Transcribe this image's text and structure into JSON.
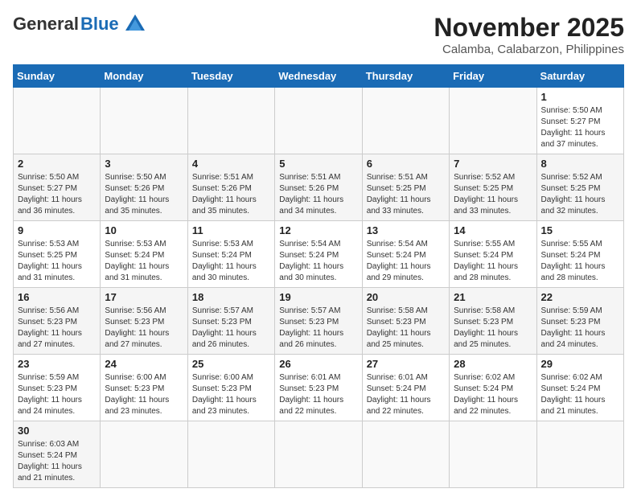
{
  "header": {
    "logo_general": "General",
    "logo_blue": "Blue",
    "month_title": "November 2025",
    "location": "Calamba, Calabarzon, Philippines"
  },
  "weekdays": [
    "Sunday",
    "Monday",
    "Tuesday",
    "Wednesday",
    "Thursday",
    "Friday",
    "Saturday"
  ],
  "weeks": [
    [
      {
        "day": null,
        "info": null
      },
      {
        "day": null,
        "info": null
      },
      {
        "day": null,
        "info": null
      },
      {
        "day": null,
        "info": null
      },
      {
        "day": null,
        "info": null
      },
      {
        "day": null,
        "info": null
      },
      {
        "day": "1",
        "info": "Sunrise: 5:50 AM\nSunset: 5:27 PM\nDaylight: 11 hours\nand 37 minutes."
      }
    ],
    [
      {
        "day": "2",
        "info": "Sunrise: 5:50 AM\nSunset: 5:27 PM\nDaylight: 11 hours\nand 36 minutes."
      },
      {
        "day": "3",
        "info": "Sunrise: 5:50 AM\nSunset: 5:26 PM\nDaylight: 11 hours\nand 35 minutes."
      },
      {
        "day": "4",
        "info": "Sunrise: 5:51 AM\nSunset: 5:26 PM\nDaylight: 11 hours\nand 35 minutes."
      },
      {
        "day": "5",
        "info": "Sunrise: 5:51 AM\nSunset: 5:26 PM\nDaylight: 11 hours\nand 34 minutes."
      },
      {
        "day": "6",
        "info": "Sunrise: 5:51 AM\nSunset: 5:25 PM\nDaylight: 11 hours\nand 33 minutes."
      },
      {
        "day": "7",
        "info": "Sunrise: 5:52 AM\nSunset: 5:25 PM\nDaylight: 11 hours\nand 33 minutes."
      },
      {
        "day": "8",
        "info": "Sunrise: 5:52 AM\nSunset: 5:25 PM\nDaylight: 11 hours\nand 32 minutes."
      }
    ],
    [
      {
        "day": "9",
        "info": "Sunrise: 5:53 AM\nSunset: 5:25 PM\nDaylight: 11 hours\nand 31 minutes."
      },
      {
        "day": "10",
        "info": "Sunrise: 5:53 AM\nSunset: 5:24 PM\nDaylight: 11 hours\nand 31 minutes."
      },
      {
        "day": "11",
        "info": "Sunrise: 5:53 AM\nSunset: 5:24 PM\nDaylight: 11 hours\nand 30 minutes."
      },
      {
        "day": "12",
        "info": "Sunrise: 5:54 AM\nSunset: 5:24 PM\nDaylight: 11 hours\nand 30 minutes."
      },
      {
        "day": "13",
        "info": "Sunrise: 5:54 AM\nSunset: 5:24 PM\nDaylight: 11 hours\nand 29 minutes."
      },
      {
        "day": "14",
        "info": "Sunrise: 5:55 AM\nSunset: 5:24 PM\nDaylight: 11 hours\nand 28 minutes."
      },
      {
        "day": "15",
        "info": "Sunrise: 5:55 AM\nSunset: 5:24 PM\nDaylight: 11 hours\nand 28 minutes."
      }
    ],
    [
      {
        "day": "16",
        "info": "Sunrise: 5:56 AM\nSunset: 5:23 PM\nDaylight: 11 hours\nand 27 minutes."
      },
      {
        "day": "17",
        "info": "Sunrise: 5:56 AM\nSunset: 5:23 PM\nDaylight: 11 hours\nand 27 minutes."
      },
      {
        "day": "18",
        "info": "Sunrise: 5:57 AM\nSunset: 5:23 PM\nDaylight: 11 hours\nand 26 minutes."
      },
      {
        "day": "19",
        "info": "Sunrise: 5:57 AM\nSunset: 5:23 PM\nDaylight: 11 hours\nand 26 minutes."
      },
      {
        "day": "20",
        "info": "Sunrise: 5:58 AM\nSunset: 5:23 PM\nDaylight: 11 hours\nand 25 minutes."
      },
      {
        "day": "21",
        "info": "Sunrise: 5:58 AM\nSunset: 5:23 PM\nDaylight: 11 hours\nand 25 minutes."
      },
      {
        "day": "22",
        "info": "Sunrise: 5:59 AM\nSunset: 5:23 PM\nDaylight: 11 hours\nand 24 minutes."
      }
    ],
    [
      {
        "day": "23",
        "info": "Sunrise: 5:59 AM\nSunset: 5:23 PM\nDaylight: 11 hours\nand 24 minutes."
      },
      {
        "day": "24",
        "info": "Sunrise: 6:00 AM\nSunset: 5:23 PM\nDaylight: 11 hours\nand 23 minutes."
      },
      {
        "day": "25",
        "info": "Sunrise: 6:00 AM\nSunset: 5:23 PM\nDaylight: 11 hours\nand 23 minutes."
      },
      {
        "day": "26",
        "info": "Sunrise: 6:01 AM\nSunset: 5:23 PM\nDaylight: 11 hours\nand 22 minutes."
      },
      {
        "day": "27",
        "info": "Sunrise: 6:01 AM\nSunset: 5:24 PM\nDaylight: 11 hours\nand 22 minutes."
      },
      {
        "day": "28",
        "info": "Sunrise: 6:02 AM\nSunset: 5:24 PM\nDaylight: 11 hours\nand 22 minutes."
      },
      {
        "day": "29",
        "info": "Sunrise: 6:02 AM\nSunset: 5:24 PM\nDaylight: 11 hours\nand 21 minutes."
      }
    ],
    [
      {
        "day": "30",
        "info": "Sunrise: 6:03 AM\nSunset: 5:24 PM\nDaylight: 11 hours\nand 21 minutes."
      },
      {
        "day": null,
        "info": null
      },
      {
        "day": null,
        "info": null
      },
      {
        "day": null,
        "info": null
      },
      {
        "day": null,
        "info": null
      },
      {
        "day": null,
        "info": null
      },
      {
        "day": null,
        "info": null
      }
    ]
  ]
}
